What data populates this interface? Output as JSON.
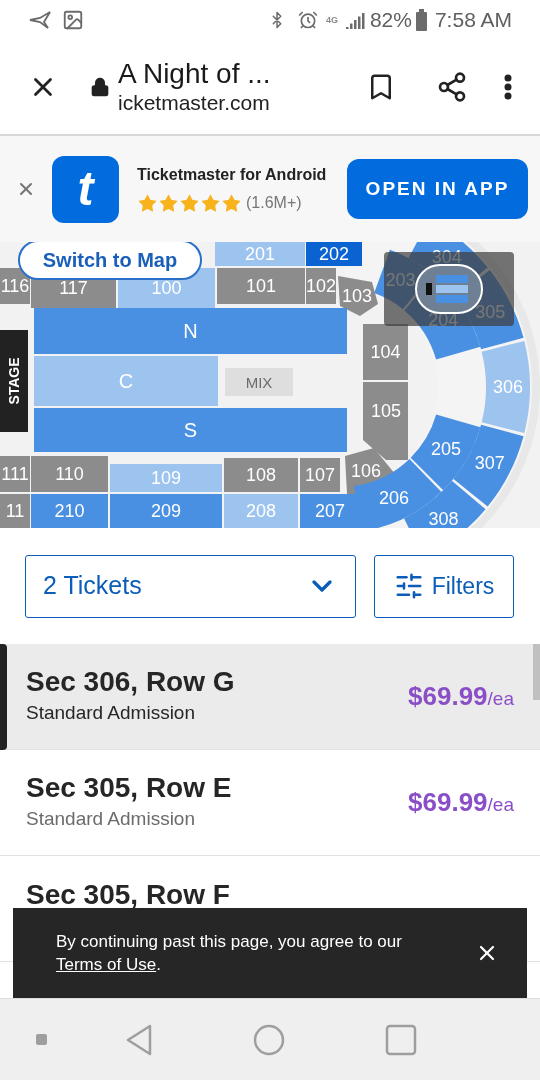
{
  "status_bar": {
    "battery": "82%",
    "time": "7:58 AM",
    "network": "4G"
  },
  "browser": {
    "title": "A Night of ...",
    "url": "icketmaster.com"
  },
  "app_banner": {
    "logo": "t",
    "name": "Ticketmaster for Android",
    "stars": 5,
    "reviews": "(1.6M+)",
    "button": "OPEN IN APP"
  },
  "seat_map": {
    "switch_button": "Switch to Map",
    "stage": "STAGE",
    "sections": [
      {
        "label": "201",
        "color": "#9dc3ef"
      },
      {
        "label": "202",
        "color": "#0a63d1"
      },
      {
        "label": "116",
        "color": "#8c8c8c"
      },
      {
        "label": "117",
        "color": "#8c8c8c"
      },
      {
        "label": "100",
        "color": "#9dc3ef"
      },
      {
        "label": "101",
        "color": "#8c8c8c"
      },
      {
        "label": "102",
        "color": "#8c8c8c"
      },
      {
        "label": "103",
        "color": "#8c8c8c"
      },
      {
        "label": "N",
        "color": "#4a90e2"
      },
      {
        "label": "C",
        "color": "#9dc3ef"
      },
      {
        "label": "MIX",
        "color": "#dedede"
      },
      {
        "label": "S",
        "color": "#4a90e2"
      },
      {
        "label": "104",
        "color": "#8c8c8c"
      },
      {
        "label": "105",
        "color": "#8c8c8c"
      },
      {
        "label": "111",
        "color": "#8c8c8c"
      },
      {
        "label": "110",
        "color": "#8c8c8c"
      },
      {
        "label": "109",
        "color": "#9dc3ef"
      },
      {
        "label": "108",
        "color": "#8c8c8c"
      },
      {
        "label": "107",
        "color": "#8c8c8c"
      },
      {
        "label": "106",
        "color": "#8c8c8c"
      },
      {
        "label": "11",
        "color": "#8c8c8c"
      },
      {
        "label": "210",
        "color": "#4a90e2"
      },
      {
        "label": "209",
        "color": "#4a90e2"
      },
      {
        "label": "208",
        "color": "#9dc3ef"
      },
      {
        "label": "207",
        "color": "#4a90e2"
      },
      {
        "label": "203",
        "color": "#4a90e2"
      },
      {
        "label": "204",
        "color": "#4a90e2"
      },
      {
        "label": "205",
        "color": "#4a90e2"
      },
      {
        "label": "206",
        "color": "#4a90e2"
      },
      {
        "label": "304",
        "color": "#4a90e2"
      },
      {
        "label": "305",
        "color": "#4a90e2"
      },
      {
        "label": "306",
        "color": "#9dc3ef"
      },
      {
        "label": "307",
        "color": "#4a90e2"
      },
      {
        "label": "308",
        "color": "#4a90e2"
      }
    ]
  },
  "controls": {
    "ticket_count": "2 Tickets",
    "filters": "Filters"
  },
  "listings": [
    {
      "section": "Sec 306, Row G",
      "type": "Standard Admission",
      "price": "$69.99",
      "unit": "/ea",
      "selected": true
    },
    {
      "section": "Sec 305, Row E",
      "type": "Standard Admission",
      "price": "$69.99",
      "unit": "/ea",
      "selected": false
    },
    {
      "section": "Sec 305, Row F",
      "selected": false
    }
  ],
  "toast": {
    "message": "By continuing past this page, you agree to our ",
    "link": "Terms of Use",
    "end": "."
  }
}
